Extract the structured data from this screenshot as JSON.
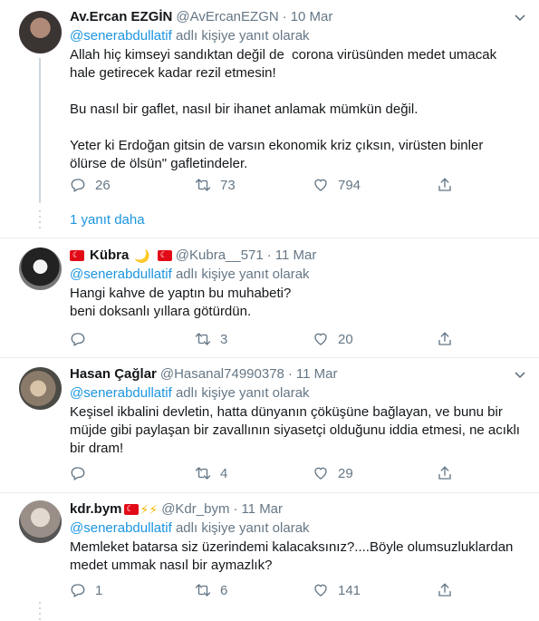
{
  "colors": {
    "accent": "#1b95e0",
    "muted": "#657786",
    "text": "#14171a",
    "divider": "#e6ecf0"
  },
  "tweets": [
    {
      "name": "Av.Ercan EZGİN",
      "handle": "@AvErcanEZGN",
      "date": "10 Mar",
      "mention": "@senerabdullatif",
      "reply_suffix": "adlı kişiye yanıt olarak",
      "paragraphs": [
        "Allah hiç kimseyi sandıktan değil de  corona virüsünden medet umacak\nhale getirecek kadar rezil etmesin!",
        "Bu nasıl bir gaflet, nasıl bir ihanet anlamak mümkün değil.",
        "Yeter ki Erdoğan gitsin de varsın ekonomik kriz çıksın, virüsten binler\nölürse de ölsün\" gafletindeler."
      ],
      "replies": "26",
      "retweets": "73",
      "likes": "794",
      "more_replies": "1 yanıt daha"
    },
    {
      "name": "Kübra",
      "name_suffix": "🌙",
      "handle": "@Kubra__571",
      "date": "11 Mar",
      "mention": "@senerabdullatif",
      "reply_suffix": "adlı kişiye yanıt olarak",
      "paragraphs": [
        "Hangi kahve de yaptın bu muhabeti?\nbeni doksanlı yıllara götürdün."
      ],
      "replies": "",
      "retweets": "3",
      "likes": "20"
    },
    {
      "name": "Hasan Çağlar",
      "handle": "@Hasanal74990378",
      "date": "11 Mar",
      "mention": "@senerabdullatif",
      "reply_suffix": "adlı kişiye yanıt olarak",
      "paragraphs": [
        "Keşisel ikbalini devletin, hatta dünyanın çöküşüne bağlayan, ve bunu bir\nmüjde gibi paylaşan bir zavallının siyasetçi olduğunu iddia etmesi, ne acıklı\nbir dram!"
      ],
      "replies": "",
      "retweets": "4",
      "likes": "29"
    },
    {
      "name": "kdr.bym",
      "name_suffix": "⚡⚡",
      "handle": "@Kdr_bym",
      "date": "11 Mar",
      "mention": "@senerabdullatif",
      "reply_suffix": "adlı kişiye yanıt olarak",
      "paragraphs": [
        "Memleket batarsa siz üzerindemi kalacaksınız?....Böyle olumsuzluklardan\nmedet ummak nasıl bir aymazlık?"
      ],
      "replies": "1",
      "retweets": "6",
      "likes": "141"
    }
  ]
}
